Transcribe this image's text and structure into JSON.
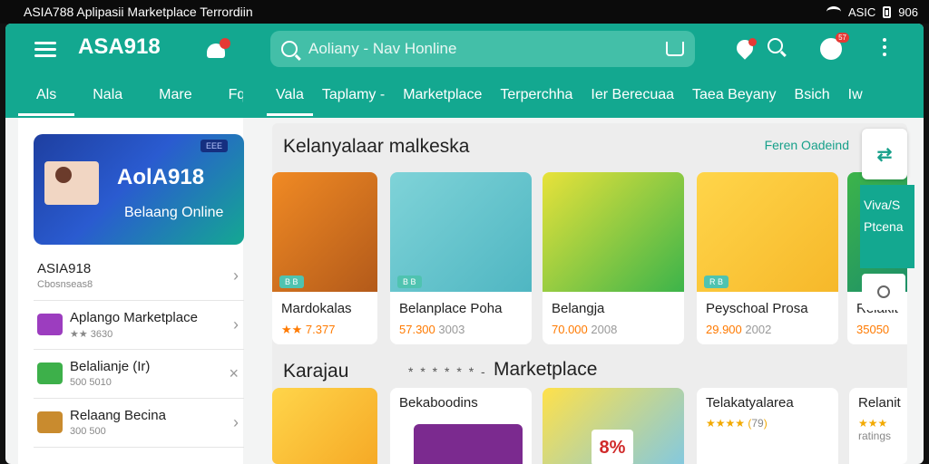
{
  "statusbar": {
    "title": "ASIA788 Aplipasii Marketplace Terrordiin",
    "carrier": "ASIC",
    "time": "906"
  },
  "left_header": {
    "brand": "ASA918",
    "tabs": [
      "Als",
      "Nala",
      "Mare",
      "Fq"
    ]
  },
  "main_header": {
    "search_placeholder": "Aoliany - Nav Honline",
    "notif_badge": "57",
    "tabs": [
      "Vala",
      "Taplamy -",
      "Marketplace",
      "Terperchha",
      "Ier Berecuaa",
      "Taea Beyany",
      "Bsich",
      "Iw"
    ]
  },
  "sidebar": {
    "banner": {
      "badge": "EEE",
      "title": "AolA918",
      "subtitle": "Belaang Online"
    },
    "items": [
      {
        "name": "ASIA918",
        "sub": "Cbosnseas8"
      },
      {
        "name": "Aplango Marketplace",
        "sub": "★★ 3630"
      },
      {
        "name": "Belalianje (Ir)",
        "sub": "500 5010"
      },
      {
        "name": "Relaang Becina",
        "sub": "300 500"
      }
    ]
  },
  "content": {
    "section1": {
      "title": "Kelanyalaar malkeska",
      "link": "Feren Oadeind"
    },
    "products": [
      {
        "name": "Mardokalas",
        "price": "★★ 7.377",
        "tag": "B B"
      },
      {
        "name": "Belanplace Poha",
        "price": "57.300",
        "rating": "3003",
        "tag": "B B"
      },
      {
        "name": "Belangja",
        "price": "70.000",
        "rating": "2008"
      },
      {
        "name": "Peyschoal Prosa",
        "price": "29.900",
        "rating": "2002",
        "tag": "R B"
      },
      {
        "name": "Relakit",
        "price": "35050"
      }
    ],
    "section2": {
      "title": "Karajau",
      "stars": "* * * * * * -",
      "marketplace": "Marketplace"
    },
    "products2": [
      {
        "name": ""
      },
      {
        "name": "Bekaboodins"
      },
      {
        "name": ""
      },
      {
        "name": "Telakatyalarea",
        "stars": "★★★★",
        "rating": "79"
      },
      {
        "name": "Relanit",
        "stars": "★★★",
        "rating": "ratings"
      }
    ],
    "promo": "8%"
  },
  "float_panel": {
    "text1": "Viva/S",
    "text2": "Ptcena"
  },
  "colors": {
    "brand_teal": "#13a890",
    "price_orange": "#ff7a00",
    "badge_red": "#e53935"
  }
}
